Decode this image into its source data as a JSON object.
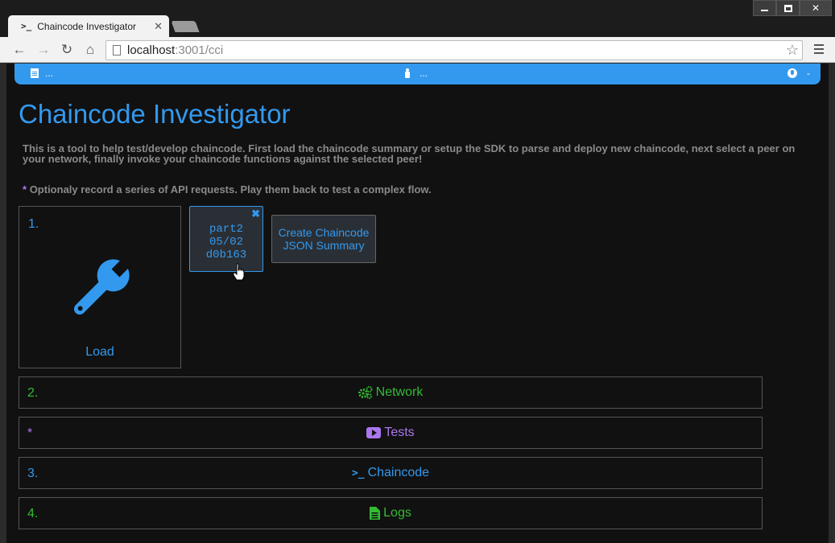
{
  "browser": {
    "tab_title": "Chaincode Investigator",
    "tab_icon": ">_",
    "url_host": "localhost",
    "url_rest": ":3001/cci"
  },
  "appbar": {
    "left_text": "...",
    "middle_text": "...",
    "right_text": "-"
  },
  "main": {
    "title": "Chaincode Investigator",
    "intro": "This is a tool to help test/develop chaincode. First load the chaincode summary or setup the SDK to parse and deploy new chaincode, next select a peer on your network, finally invoke your chaincode functions against the selected peer!",
    "note_star": "*",
    "note": "Optionaly record a series of API requests. Play them back to test a complex flow.",
    "load_panel": {
      "num": "1.",
      "label": "Load"
    },
    "file_card": {
      "line1": "part2",
      "line2": "05/02",
      "line3": "d0b163",
      "close": "✖"
    },
    "create_button": {
      "line1": "Create Chaincode",
      "line2": "JSON Summary"
    },
    "sections": [
      {
        "num": "2.",
        "label": "Network",
        "icon": "cogs-icon",
        "color": "#33bb33"
      },
      {
        "num": "*",
        "label": "Tests",
        "icon": "play-icon",
        "color": "#aa77ee"
      },
      {
        "num": "3.",
        "label": "Chaincode",
        "icon": "terminal-icon",
        "color": "#3399ee"
      },
      {
        "num": "4.",
        "label": "Logs",
        "icon": "file-icon",
        "color": "#33bb33"
      }
    ]
  },
  "colors": {
    "accent": "#3399ee",
    "green": "#33bb33",
    "purple": "#aa77ee",
    "background": "#111111"
  }
}
